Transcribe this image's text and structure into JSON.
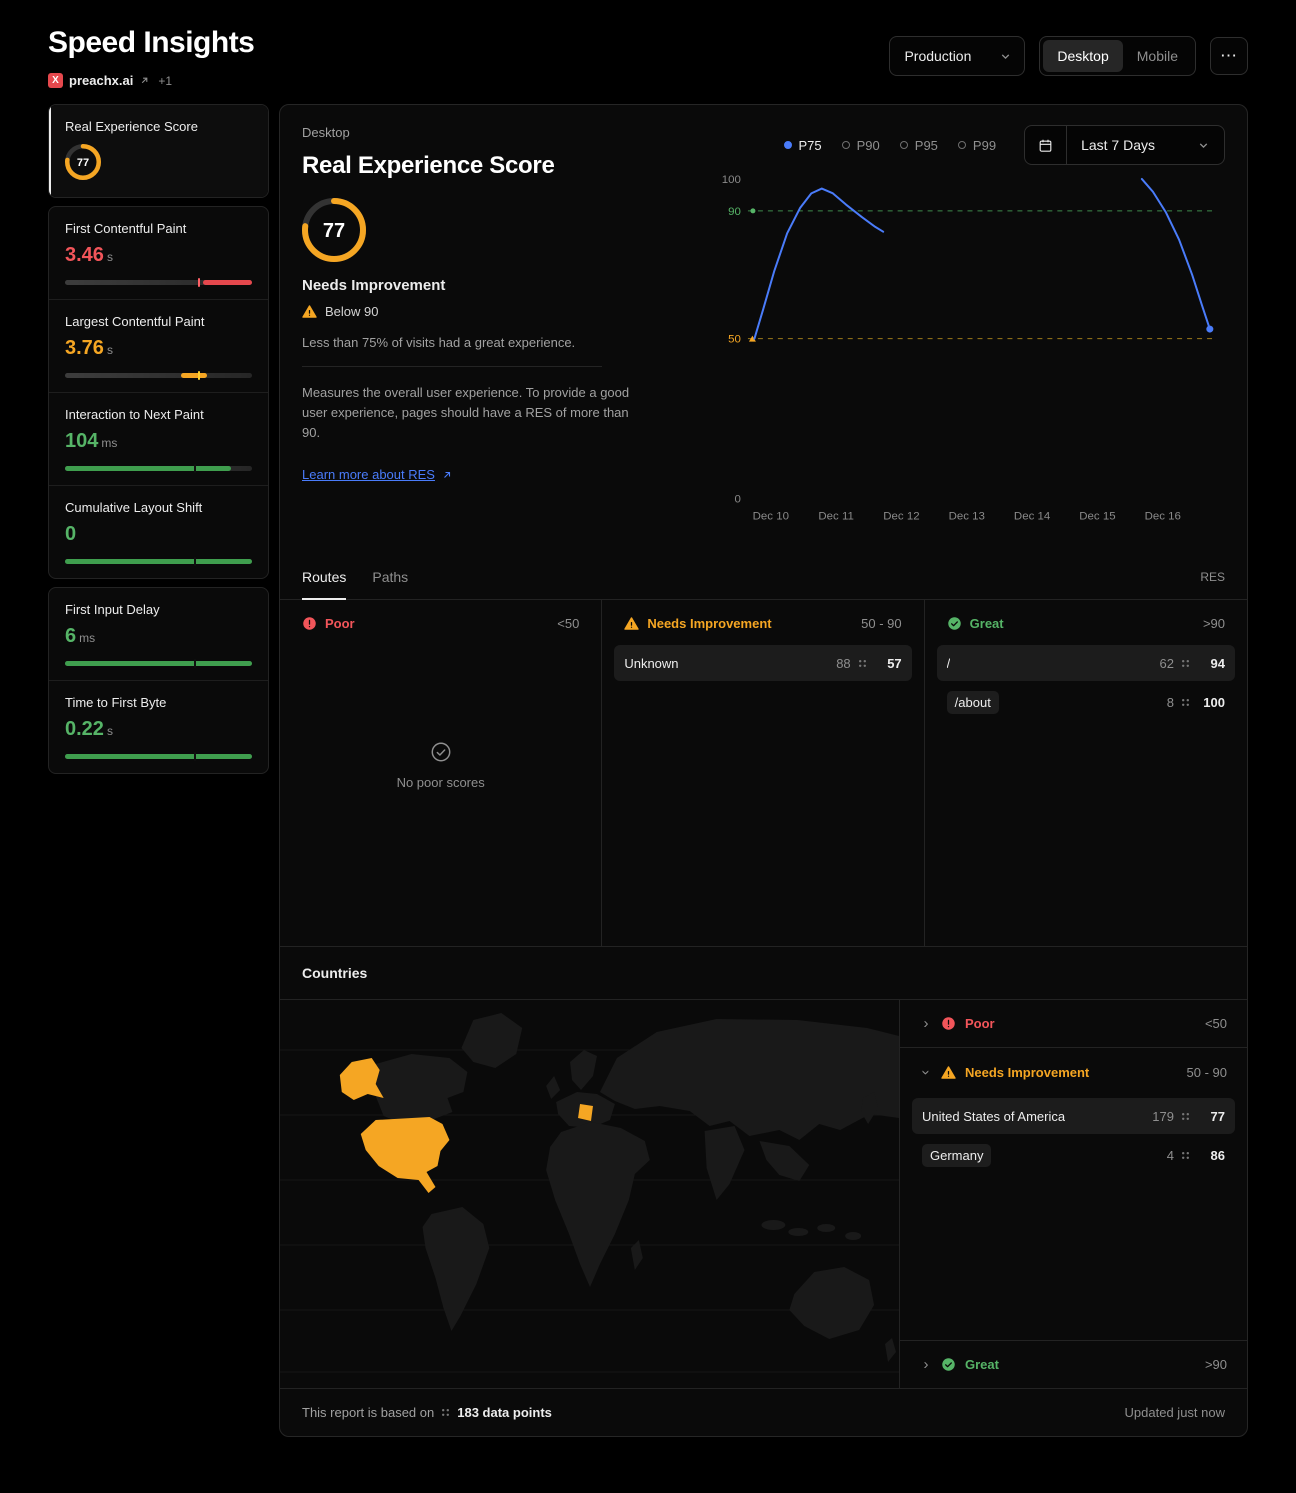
{
  "header": {
    "title": "Speed Insights",
    "project": {
      "logo_letter": "X",
      "name": "preachx.ai",
      "extra": "+1"
    },
    "environment": "Production",
    "device_toggle": {
      "options": [
        "Desktop",
        "Mobile"
      ],
      "active": "Desktop"
    }
  },
  "sidebar": {
    "groups": [
      [
        0
      ],
      [
        1,
        2,
        3,
        4
      ],
      [
        5,
        6
      ]
    ],
    "items": [
      {
        "id": "res",
        "label": "Real Experience Score",
        "type": "gauge",
        "value": "77",
        "selected": true
      },
      {
        "id": "fcp",
        "label": "First Contentful Paint",
        "value": "3.46",
        "unit": "s",
        "value_color": "#f2555a",
        "bar": {
          "fill_color": "#e5484d",
          "fill_start": 74,
          "fill_end": 100,
          "marker_pct": 71,
          "marker_color": "#ff6166"
        }
      },
      {
        "id": "lcp",
        "label": "Largest Contentful Paint",
        "value": "3.76",
        "unit": "s",
        "value_color": "#f5a623",
        "bar": {
          "fill_color": "#f5a623",
          "fill_start": 62,
          "fill_end": 76,
          "marker_pct": 71,
          "marker_color": "#ffd02e"
        }
      },
      {
        "id": "inp",
        "label": "Interaction to Next Paint",
        "value": "104",
        "unit": "ms",
        "value_color": "#56b467",
        "bar": {
          "fill_color": "#3f9e4e",
          "fill_start": 0,
          "fill_end": 89,
          "marker_pct": 69,
          "marker_color": "#101010"
        }
      },
      {
        "id": "cls",
        "label": "Cumulative Layout Shift",
        "value": "0",
        "unit": "",
        "value_color": "#56b467",
        "bar": {
          "fill_color": "#3f9e4e",
          "fill_start": 0,
          "fill_end": 100,
          "marker_pct": 69,
          "marker_color": "#101010"
        }
      },
      {
        "id": "fid",
        "label": "First Input Delay",
        "value": "6",
        "unit": "ms",
        "value_color": "#56b467",
        "bar": {
          "fill_color": "#3f9e4e",
          "fill_start": 0,
          "fill_end": 100,
          "marker_pct": 69,
          "marker_color": "#101010"
        }
      },
      {
        "id": "ttfb",
        "label": "Time to First Byte",
        "value": "0.22",
        "unit": "s",
        "value_color": "#56b467",
        "bar": {
          "fill_color": "#3f9e4e",
          "fill_start": 0,
          "fill_end": 100,
          "marker_pct": 69,
          "marker_color": "#101010"
        }
      }
    ]
  },
  "main": {
    "device_label": "Desktop",
    "title": "Real Experience Score",
    "score": "77",
    "score_status": "Needs Improvement",
    "score_note": "Below 90",
    "score_subtitle": "Less than 75% of visits had a great experience.",
    "description": "Measures the overall user experience. To provide a good user experience, pages should have a RES of more than 90.",
    "learn_more": "Learn more about RES",
    "percentiles": [
      {
        "label": "P75",
        "active": true
      },
      {
        "label": "P90",
        "active": false
      },
      {
        "label": "P95",
        "active": false
      },
      {
        "label": "P99",
        "active": false
      }
    ],
    "date_range": "Last 7 Days"
  },
  "chart_data": {
    "type": "line",
    "title": "Real Experience Score trend",
    "x_domain": [
      -0.35,
      6.8
    ],
    "ylim": [
      0,
      100
    ],
    "x_ticks": [
      "Dec 10",
      "Dec 11",
      "Dec 12",
      "Dec 13",
      "Dec 14",
      "Dec 15",
      "Dec 16"
    ],
    "y_ticks": [
      {
        "label": "100",
        "value": 100,
        "color": "#8a8a8a"
      },
      {
        "label": "90",
        "value": 90,
        "color": "#56b467",
        "marker": "dot"
      },
      {
        "label": "50",
        "value": 50,
        "color": "#f5a623",
        "marker": "triangle"
      },
      {
        "label": "0",
        "value": 0,
        "color": "#8a8a8a"
      }
    ],
    "reference_lines": [
      {
        "value": 90,
        "color": "#3f8a4c",
        "style": "dashed"
      },
      {
        "value": 50,
        "color": "#9c7a1a",
        "style": "dashed"
      }
    ],
    "legend": [
      "P75",
      "P90",
      "P95",
      "P99"
    ],
    "selected_series": "P75",
    "series": [
      {
        "name": "P75",
        "color": "#4a7cfa",
        "segments": [
          [
            [
              -0.25,
              50
            ],
            [
              -0.12,
              59
            ],
            [
              0.05,
              71
            ],
            [
              0.25,
              83
            ],
            [
              0.45,
              91
            ],
            [
              0.62,
              95.5
            ],
            [
              0.78,
              97
            ],
            [
              0.95,
              95.5
            ],
            [
              1.15,
              92
            ],
            [
              1.4,
              88
            ],
            [
              1.6,
              85
            ],
            [
              1.72,
              83.5
            ]
          ],
          [
            [
              5.68,
              100
            ],
            [
              5.85,
              96
            ],
            [
              6.05,
              89.5
            ],
            [
              6.25,
              81
            ],
            [
              6.45,
              70
            ],
            [
              6.6,
              60.5
            ],
            [
              6.72,
              53
            ]
          ]
        ]
      }
    ]
  },
  "routes_section": {
    "tabs": [
      {
        "label": "Routes",
        "active": true
      },
      {
        "label": "Paths",
        "active": false
      }
    ],
    "metric_label": "RES",
    "columns": [
      {
        "id": "poor",
        "label": "Poor",
        "range": "<50",
        "color": "#f2555a",
        "icon": "alert-circle",
        "empty_text": "No poor scores",
        "rows": []
      },
      {
        "id": "needs-improvement",
        "label": "Needs Improvement",
        "range": "50 - 90",
        "color": "#f5a623",
        "icon": "warning-triangle",
        "rows": [
          {
            "name": "Unknown",
            "count": "88",
            "score": "57",
            "highlight": true
          }
        ]
      },
      {
        "id": "great",
        "label": "Great",
        "range": ">90",
        "color": "#56b467",
        "icon": "check-circle",
        "rows": [
          {
            "name": "/",
            "count": "62",
            "score": "94",
            "highlight": true
          },
          {
            "name": "/about",
            "count": "8",
            "score": "100",
            "chip": true
          }
        ]
      }
    ]
  },
  "countries_section": {
    "title": "Countries",
    "map": {
      "highlight_color": "#f5a623",
      "land_color": "#191919",
      "highlighted": [
        "United States of America",
        "Germany"
      ]
    },
    "groups": [
      {
        "id": "poor",
        "label": "Poor",
        "range": "<50",
        "color": "#f2555a",
        "icon": "alert-circle",
        "expanded": false,
        "rows": []
      },
      {
        "id": "needs-improvement",
        "label": "Needs Improvement",
        "range": "50 - 90",
        "color": "#f5a623",
        "icon": "warning-triangle",
        "expanded": true,
        "rows": [
          {
            "name": "United States of America",
            "count": "179",
            "score": "77",
            "highlight": true
          },
          {
            "name": "Germany",
            "count": "4",
            "score": "86",
            "chip": true
          }
        ]
      },
      {
        "id": "great",
        "label": "Great",
        "range": ">90",
        "color": "#56b467",
        "icon": "check-circle",
        "expanded": false,
        "rows": []
      }
    ]
  },
  "footer": {
    "prefix": "This report is based on",
    "data_points": "183 data points",
    "updated": "Updated just now"
  }
}
